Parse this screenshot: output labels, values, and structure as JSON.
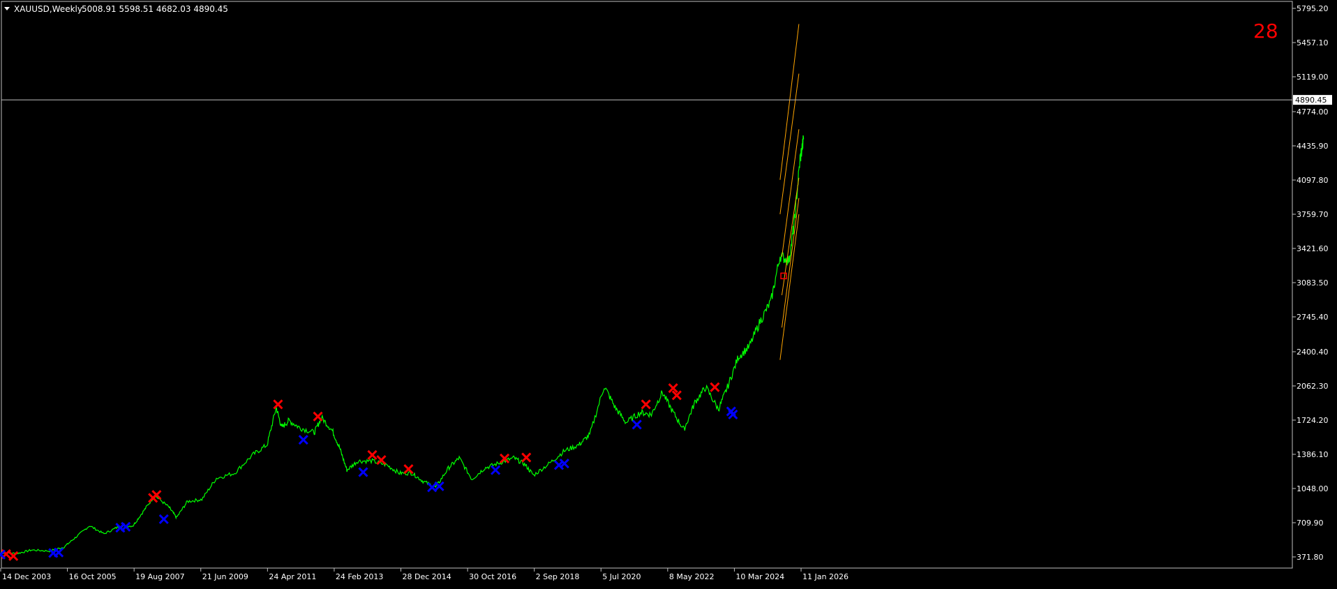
{
  "header": {
    "symbol": "XAUUSD,Weekly",
    "ohlc": "5008.91 5598.51 4682.03 4890.45"
  },
  "counter": "28",
  "current_price_label": "4890.45",
  "colors": {
    "background": "#000000",
    "price_line": "#00ff00",
    "signal_sell": "#ff0000",
    "signal_buy": "#0000ff",
    "channel": "#ffa500",
    "axis": "#ffffff",
    "counter": "#ff0000"
  },
  "chart_data": {
    "type": "line",
    "title": "",
    "xlabel": "",
    "ylabel": "",
    "grid": false,
    "ylim": [
      200,
      5850
    ],
    "y_ticks": [
      5795.2,
      5457.1,
      5119.0,
      4774.0,
      4435.9,
      4097.8,
      3759.7,
      3421.6,
      3083.5,
      2745.4,
      2400.4,
      2062.3,
      1724.2,
      1386.1,
      1048.0,
      709.9,
      371.8
    ],
    "y_tick_labels": [
      "5795.20",
      "5457.10",
      "5119.00",
      "4774.00",
      "4435.90",
      "4097.80",
      "3759.70",
      "3421.60",
      "3083.50",
      "2745.40",
      "2400.40",
      "2062.30",
      "1724.20",
      "1386.10",
      "1048.00",
      "709.90",
      "371.80"
    ],
    "x_tick_labels": [
      "14 Dec 2003",
      "16 Oct 2005",
      "19 Aug 2007",
      "21 Jun 2009",
      "24 Apr 2011",
      "24 Feb 2013",
      "28 Dec 2014",
      "30 Oct 2016",
      "2 Sep 2018",
      "5 Jul 2020",
      "8 May 2022",
      "10 Mar 2024",
      "11 Jan 2026"
    ],
    "x_tick_years": [
      2003.95,
      2005.79,
      2007.63,
      2009.47,
      2011.31,
      2013.15,
      2014.99,
      2016.83,
      2018.67,
      2020.51,
      2022.35,
      2024.19,
      2026.03
    ],
    "current_price": 4890.45,
    "series": [
      {
        "type": "line",
        "points": [
          [
            2003.9,
            410
          ],
          [
            2004.4,
            405
          ],
          [
            2004.8,
            440
          ],
          [
            2005.3,
            430
          ],
          [
            2005.7,
            470
          ],
          [
            2006.0,
            560
          ],
          [
            2006.4,
            680
          ],
          [
            2006.8,
            600
          ],
          [
            2007.2,
            670
          ],
          [
            2007.6,
            680
          ],
          [
            2007.9,
            830
          ],
          [
            2008.2,
            980
          ],
          [
            2008.6,
            860
          ],
          [
            2008.8,
            760
          ],
          [
            2009.1,
            920
          ],
          [
            2009.5,
            940
          ],
          [
            2009.9,
            1150
          ],
          [
            2010.4,
            1200
          ],
          [
            2010.9,
            1380
          ],
          [
            2011.3,
            1480
          ],
          [
            2011.55,
            1850
          ],
          [
            2011.7,
            1650
          ],
          [
            2011.9,
            1720
          ],
          [
            2012.2,
            1650
          ],
          [
            2012.6,
            1600
          ],
          [
            2012.8,
            1750
          ],
          [
            2013.1,
            1620
          ],
          [
            2013.3,
            1450
          ],
          [
            2013.5,
            1230
          ],
          [
            2013.8,
            1320
          ],
          [
            2014.2,
            1320
          ],
          [
            2014.6,
            1280
          ],
          [
            2014.95,
            1200
          ],
          [
            2015.3,
            1200
          ],
          [
            2015.6,
            1120
          ],
          [
            2015.95,
            1060
          ],
          [
            2016.3,
            1250
          ],
          [
            2016.6,
            1350
          ],
          [
            2016.95,
            1140
          ],
          [
            2017.3,
            1250
          ],
          [
            2017.7,
            1300
          ],
          [
            2018.1,
            1350
          ],
          [
            2018.4,
            1290
          ],
          [
            2018.65,
            1180
          ],
          [
            2019.1,
            1300
          ],
          [
            2019.5,
            1420
          ],
          [
            2019.9,
            1480
          ],
          [
            2020.2,
            1580
          ],
          [
            2020.6,
            2060
          ],
          [
            2020.9,
            1850
          ],
          [
            2021.2,
            1700
          ],
          [
            2021.6,
            1800
          ],
          [
            2021.9,
            1780
          ],
          [
            2022.2,
            2000
          ],
          [
            2022.5,
            1800
          ],
          [
            2022.8,
            1630
          ],
          [
            2023.1,
            1900
          ],
          [
            2023.4,
            2050
          ],
          [
            2023.75,
            1830
          ],
          [
            2024.0,
            2050
          ],
          [
            2024.3,
            2350
          ],
          [
            2024.6,
            2450
          ],
          [
            2024.9,
            2700
          ],
          [
            2025.2,
            2900
          ],
          [
            2025.45,
            3350
          ],
          [
            2025.7,
            3300
          ],
          [
            2025.85,
            3700
          ],
          [
            2026.0,
            4300
          ],
          [
            2026.1,
            4500
          ]
        ]
      }
    ],
    "signals": [
      {
        "type": "sell",
        "x": 2004.1,
        "y": 400
      },
      {
        "type": "sell",
        "x": 2004.3,
        "y": 380
      },
      {
        "type": "buy",
        "x": 2003.95,
        "y": 395
      },
      {
        "type": "buy",
        "x": 2005.4,
        "y": 410
      },
      {
        "type": "buy",
        "x": 2005.55,
        "y": 415
      },
      {
        "type": "buy",
        "x": 2007.25,
        "y": 660
      },
      {
        "type": "buy",
        "x": 2007.4,
        "y": 670
      },
      {
        "type": "sell",
        "x": 2008.15,
        "y": 955
      },
      {
        "type": "sell",
        "x": 2008.25,
        "y": 985
      },
      {
        "type": "buy",
        "x": 2008.45,
        "y": 745
      },
      {
        "type": "sell",
        "x": 2011.6,
        "y": 1880
      },
      {
        "type": "buy",
        "x": 2012.3,
        "y": 1530
      },
      {
        "type": "sell",
        "x": 2012.7,
        "y": 1760
      },
      {
        "type": "buy",
        "x": 2013.95,
        "y": 1210
      },
      {
        "type": "sell",
        "x": 2014.2,
        "y": 1380
      },
      {
        "type": "sell",
        "x": 2014.45,
        "y": 1330
      },
      {
        "type": "sell",
        "x": 2015.2,
        "y": 1240
      },
      {
        "type": "buy",
        "x": 2015.85,
        "y": 1060
      },
      {
        "type": "buy",
        "x": 2016.05,
        "y": 1070
      },
      {
        "type": "buy",
        "x": 2017.6,
        "y": 1230
      },
      {
        "type": "sell",
        "x": 2017.85,
        "y": 1345
      },
      {
        "type": "sell",
        "x": 2018.45,
        "y": 1355
      },
      {
        "type": "buy",
        "x": 2019.35,
        "y": 1280
      },
      {
        "type": "buy",
        "x": 2019.5,
        "y": 1295
      },
      {
        "type": "buy",
        "x": 2021.5,
        "y": 1680
      },
      {
        "type": "sell",
        "x": 2021.75,
        "y": 1880
      },
      {
        "type": "sell",
        "x": 2022.5,
        "y": 2040
      },
      {
        "type": "sell",
        "x": 2022.6,
        "y": 1970
      },
      {
        "type": "sell",
        "x": 2023.65,
        "y": 2050
      },
      {
        "type": "buy",
        "x": 2024.1,
        "y": 1810
      },
      {
        "type": "buy",
        "x": 2024.15,
        "y": 1780
      }
    ],
    "channel_lines": [
      [
        [
          2025.45,
          4100
        ],
        [
          2025.97,
          5640
        ]
      ],
      [
        [
          2025.45,
          3760
        ],
        [
          2025.97,
          5150
        ]
      ],
      [
        [
          2025.5,
          3340
        ],
        [
          2025.97,
          4600
        ]
      ],
      [
        [
          2025.5,
          2960
        ],
        [
          2025.97,
          4120
        ]
      ],
      [
        [
          2025.5,
          2640
        ],
        [
          2025.97,
          3920
        ]
      ],
      [
        [
          2025.45,
          2320
        ],
        [
          2025.97,
          3760
        ]
      ]
    ],
    "marker": {
      "x": 2025.55,
      "y": 3150
    }
  }
}
